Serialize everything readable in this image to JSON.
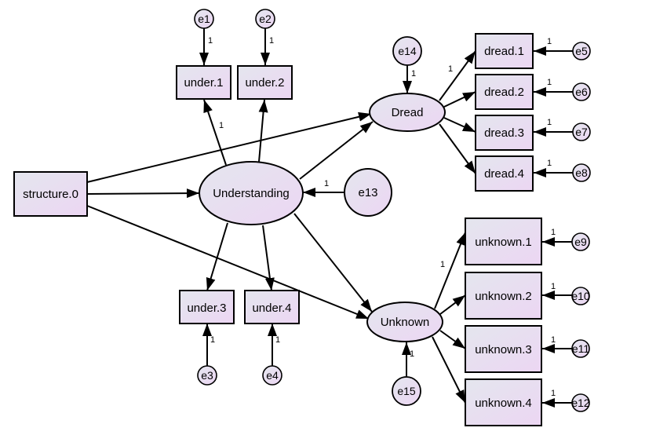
{
  "diagram": {
    "type": "structural-equation-model",
    "observed": {
      "structure": "structure.0",
      "under": [
        "under.1",
        "under.2",
        "under.3",
        "under.4"
      ],
      "dread": [
        "dread.1",
        "dread.2",
        "dread.3",
        "dread.4"
      ],
      "unknown": [
        "unknown.1",
        "unknown.2",
        "unknown.3",
        "unknown.4"
      ]
    },
    "latent": {
      "understanding": "Understanding",
      "dread": "Dread",
      "unknown": "Unknown"
    },
    "errors": {
      "e1": "e1",
      "e2": "e2",
      "e3": "e3",
      "e4": "e4",
      "e5": "e5",
      "e6": "e6",
      "e7": "e7",
      "e8": "e8",
      "e9": "e9",
      "e10": "e10",
      "e11": "e11",
      "e12": "e12",
      "e13": "e13",
      "e14": "e14",
      "e15": "e15"
    },
    "fixed_loading": "1",
    "edges": [
      {
        "from": "e1",
        "to": "under.1",
        "label": "1"
      },
      {
        "from": "e2",
        "to": "under.2",
        "label": "1"
      },
      {
        "from": "e3",
        "to": "under.3",
        "label": "1"
      },
      {
        "from": "e4",
        "to": "under.4",
        "label": "1"
      },
      {
        "from": "Understanding",
        "to": "under.1",
        "label": "1"
      },
      {
        "from": "Understanding",
        "to": "under.2",
        "label": ""
      },
      {
        "from": "Understanding",
        "to": "under.3",
        "label": ""
      },
      {
        "from": "Understanding",
        "to": "under.4",
        "label": ""
      },
      {
        "from": "structure.0",
        "to": "Understanding",
        "label": ""
      },
      {
        "from": "structure.0",
        "to": "Dread",
        "label": ""
      },
      {
        "from": "structure.0",
        "to": "Unknown",
        "label": ""
      },
      {
        "from": "Understanding",
        "to": "Dread",
        "label": ""
      },
      {
        "from": "Understanding",
        "to": "Unknown",
        "label": ""
      },
      {
        "from": "e13",
        "to": "Understanding",
        "label": "1"
      },
      {
        "from": "e14",
        "to": "Dread",
        "label": "1"
      },
      {
        "from": "e15",
        "to": "Unknown",
        "label": "1"
      },
      {
        "from": "Dread",
        "to": "dread.1",
        "label": "1"
      },
      {
        "from": "Dread",
        "to": "dread.2",
        "label": ""
      },
      {
        "from": "Dread",
        "to": "dread.3",
        "label": ""
      },
      {
        "from": "Dread",
        "to": "dread.4",
        "label": ""
      },
      {
        "from": "Unknown",
        "to": "unknown.1",
        "label": "1"
      },
      {
        "from": "Unknown",
        "to": "unknown.2",
        "label": ""
      },
      {
        "from": "Unknown",
        "to": "unknown.3",
        "label": ""
      },
      {
        "from": "Unknown",
        "to": "unknown.4",
        "label": ""
      },
      {
        "from": "e5",
        "to": "dread.1",
        "label": "1"
      },
      {
        "from": "e6",
        "to": "dread.2",
        "label": "1"
      },
      {
        "from": "e7",
        "to": "dread.3",
        "label": "1"
      },
      {
        "from": "e8",
        "to": "dread.4",
        "label": "1"
      },
      {
        "from": "e9",
        "to": "unknown.1",
        "label": "1"
      },
      {
        "from": "e10",
        "to": "unknown.2",
        "label": "1"
      },
      {
        "from": "e11",
        "to": "unknown.3",
        "label": "1"
      },
      {
        "from": "e12",
        "to": "unknown.4",
        "label": "1"
      }
    ],
    "colors": {
      "fill_start": "#e4e6ee",
      "fill_end": "#ead6f2",
      "stroke": "#000000"
    }
  }
}
